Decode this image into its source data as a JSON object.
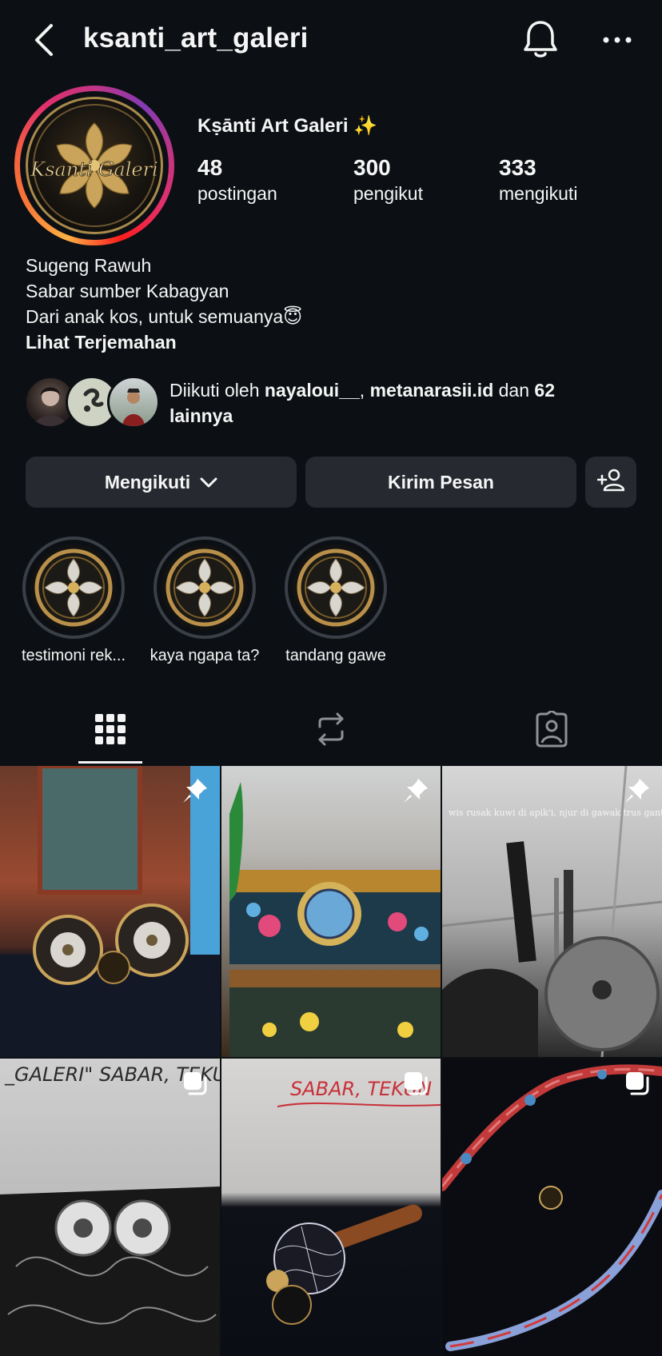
{
  "header": {
    "username": "ksanti_art_galeri",
    "back_icon": "chevron-left-icon",
    "bell_icon": "bell-icon",
    "more_icon": "more-horizontal-icon"
  },
  "profile": {
    "display_name": "Kṣānti Art Galeri ✨",
    "stats": [
      {
        "value": "48",
        "label": "postingan"
      },
      {
        "value": "300",
        "label": "pengikut"
      },
      {
        "value": "333",
        "label": "mengikuti"
      }
    ],
    "bio": [
      "Sugeng Rawuh",
      "Sabar sumber Kabagyan",
      "Dari anak kos, untuk semuanya😇"
    ],
    "translate_link": "Lihat Terjemahan",
    "followed_by": {
      "prefix": "Diikuti oleh ",
      "user1": "nayaloui__",
      "sep": ", ",
      "user2": "metanarasii.id",
      "mid": " dan ",
      "count": "62",
      "suffix": "lainnya"
    }
  },
  "actions": {
    "following_label": "Mengikuti",
    "message_label": "Kirim Pesan"
  },
  "highlights": [
    {
      "label": "testimoni rek..."
    },
    {
      "label": "kaya ngapa ta?"
    },
    {
      "label": "tandang gawe"
    }
  ],
  "tabs": [
    "grid-icon",
    "reels-repost-icon",
    "tagged-icon"
  ],
  "posts": [
    {
      "badge": "pin-icon",
      "caption": ""
    },
    {
      "badge": "pin-icon",
      "caption": ""
    },
    {
      "badge": "pin-icon",
      "caption": "wis rusak kuwi di apik'i, njur di gawak trus ganti liane"
    },
    {
      "badge": "carousel-icon",
      "caption": "_GALERI\" SABAR, TEKUN, TEKAN"
    },
    {
      "badge": "carousel-icon",
      "caption": "SABAR, TEKUN"
    },
    {
      "badge": "carousel-icon",
      "caption": ""
    }
  ],
  "colors": {
    "background": "#0c1014",
    "button": "#262a30",
    "text": "#f5f5f5",
    "gold": "#c9a45a"
  }
}
